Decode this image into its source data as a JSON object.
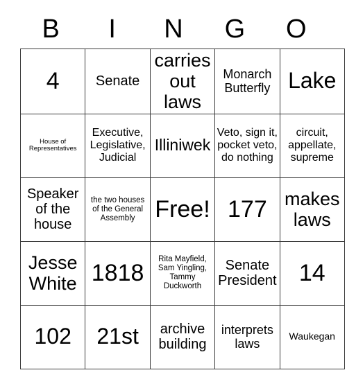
{
  "card": {
    "header_letters": [
      "B",
      "I",
      "N",
      "G",
      "O"
    ],
    "colors": {
      "background": "#ffffff",
      "text": "#000000",
      "border": "#3a3a3a"
    },
    "rows": [
      [
        {
          "text": "4",
          "size": "fs-xxl"
        },
        {
          "text": "Senate",
          "size": "fs-m"
        },
        {
          "text": "carries out laws",
          "size": "fs-l"
        },
        {
          "text": "Monarch Butterfly",
          "size": "fs-sm"
        },
        {
          "text": "Lake",
          "size": "fs-xl"
        }
      ],
      [
        {
          "text": "House of Representatives",
          "size": "fs-tiny"
        },
        {
          "text": "Executive, Legislative, Judicial",
          "size": "fs-s"
        },
        {
          "text": "Illiniwek",
          "size": "fs-ml"
        },
        {
          "text": "Veto, sign it, pocket veto, do nothing",
          "size": "fs-s"
        },
        {
          "text": "circuit, appellate, supreme",
          "size": "fs-s"
        }
      ],
      [
        {
          "text": "Speaker of the house",
          "size": "fs-m"
        },
        {
          "text": "the two houses of the General Assembly",
          "size": "fs-xxs"
        },
        {
          "text": "Free!",
          "size": "fs-xxl"
        },
        {
          "text": "177",
          "size": "fs-xxl"
        },
        {
          "text": "makes laws",
          "size": "fs-l"
        }
      ],
      [
        {
          "text": "Jesse White",
          "size": "fs-l"
        },
        {
          "text": "1818",
          "size": "fs-xxl"
        },
        {
          "text": "Rita Mayfield, Sam Yingling, Tammy Duckworth",
          "size": "fs-xxs"
        },
        {
          "text": "Senate President",
          "size": "fs-m"
        },
        {
          "text": "14",
          "size": "fs-xxl"
        }
      ],
      [
        {
          "text": "102",
          "size": "fs-xl"
        },
        {
          "text": "21st",
          "size": "fs-xl"
        },
        {
          "text": "archive building",
          "size": "fs-m"
        },
        {
          "text": "interprets laws",
          "size": "fs-sm"
        },
        {
          "text": "Waukegan",
          "size": "fs-xs"
        }
      ]
    ]
  }
}
